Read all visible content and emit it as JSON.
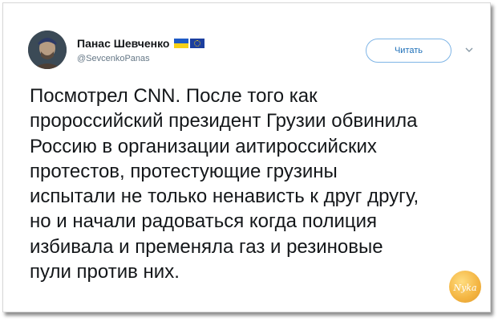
{
  "tweet": {
    "display_name": "Панас Шевченко",
    "handle": "@SevcenkoPanas",
    "follow_label": "Читать",
    "text": "Посмотрел CNN. После того как\nпророссийский президент Грузии обвинила\nРоссию в организации аитироссийских\nпротестов, протестующие грузины\nиспытали не только ненависть к друг другу,\nно и начали  радоваться когда полиция\nизбивала и пременяла газ и резиновые\nпули против них.",
    "flags": [
      "ukraine-flag-icon",
      "eu-flag-icon"
    ]
  },
  "icons": {
    "menu": "chevron-down-icon"
  },
  "watermark": {
    "text": "Nyka"
  },
  "colors": {
    "follow_border": "#7fb5e6",
    "follow_text": "#1d6fb8",
    "handle": "#657786",
    "text": "#14171a"
  }
}
